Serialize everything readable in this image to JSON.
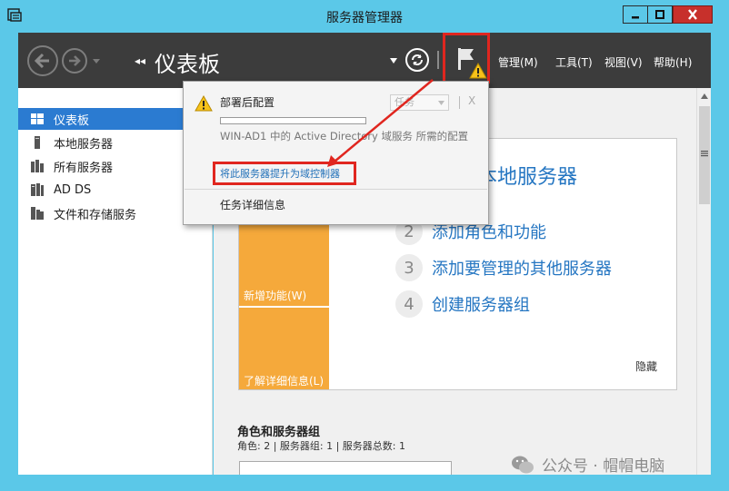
{
  "window": {
    "title": "服务器管理器",
    "minimize_label": "_",
    "maximize_label": "□",
    "close_label": "X"
  },
  "toolbar": {
    "breadcrumb_arrows": "◂◂",
    "breadcrumb_title": "仪表板",
    "menus": [
      "管理(M)",
      "工具(T)",
      "视图(V)",
      "帮助(H)"
    ]
  },
  "sidebar": {
    "items": [
      {
        "label": "仪表板",
        "icon": "dashboard-icon",
        "active": true
      },
      {
        "label": "本地服务器",
        "icon": "server-icon",
        "active": false
      },
      {
        "label": "所有服务器",
        "icon": "servers-icon",
        "active": false
      },
      {
        "label": "AD DS",
        "icon": "ad-ds-icon",
        "active": false
      },
      {
        "label": "文件和存储服务",
        "icon": "file-storage-icon",
        "active": false
      }
    ]
  },
  "notification": {
    "title": "部署后配置",
    "task_dropdown": "任务",
    "description": "WIN-AD1 中的 Active Directory 域服务 所需的配置",
    "link": "将此服务器提升为域控制器",
    "details": "任务详细信息",
    "close_label": "X"
  },
  "welcome": {
    "step1_text": "本地服务器",
    "steps": [
      {
        "num": "2",
        "text": "添加角色和功能"
      },
      {
        "num": "3",
        "text": "添加要管理的其他服务器"
      },
      {
        "num": "4",
        "text": "创建服务器组"
      }
    ],
    "new_features": "新增功能(W)",
    "learn_more": "了解详细信息(L)",
    "hide": "隐藏"
  },
  "roles": {
    "heading": "角色和服务器组",
    "summary": "角色: 2 | 服务器组: 1 | 服务器总数: 1"
  },
  "watermark": "公众号 · 帽帽电脑",
  "colors": {
    "accent_blue": "#2b7bd1",
    "orange": "#f5a93b",
    "highlight_red": "#e0261f",
    "toolbar_dark": "#3c3c3c",
    "frame_cyan": "#5bc8e8"
  }
}
